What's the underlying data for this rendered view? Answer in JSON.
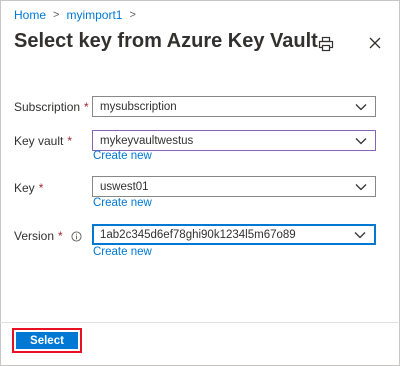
{
  "breadcrumb": {
    "home": "Home",
    "current": "myimport1"
  },
  "header": {
    "title": "Select key from Azure Key Vault",
    "print_icon": "print-icon",
    "close_icon": "close-icon"
  },
  "form": {
    "subscription": {
      "label": "Subscription",
      "required": "*",
      "value": "mysubscription"
    },
    "key_vault": {
      "label": "Key vault",
      "required": "*",
      "value": "mykeyvaultwestus",
      "create_link": "Create new"
    },
    "key": {
      "label": "Key",
      "required": "*",
      "value": "uswest01",
      "create_link": "Create new"
    },
    "version": {
      "label": "Version",
      "required": "*",
      "value": "1ab2c345d6ef78ghi90k1234l5m67o89",
      "create_link": "Create new",
      "info_icon": "info-icon"
    }
  },
  "footer": {
    "select_label": "Select"
  },
  "colors": {
    "accent": "#0078d4",
    "required": "#a4262c",
    "highlight": "#e81123"
  }
}
